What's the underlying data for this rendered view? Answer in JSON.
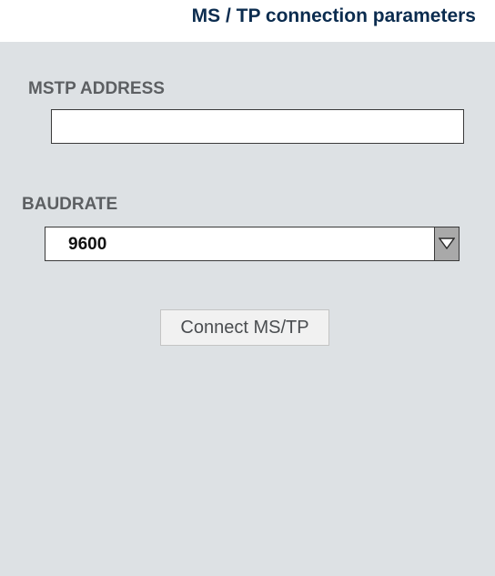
{
  "header": {
    "title": "MS / TP connection parameters"
  },
  "mstp_address": {
    "label": "MSTP ADDRESS",
    "value": "",
    "placeholder": ""
  },
  "baudrate": {
    "label": "BAUDRATE",
    "selected": "9600",
    "dropdown_icon": "triangle-down-icon"
  },
  "actions": {
    "connect_label": "Connect MS/TP"
  },
  "colors": {
    "title": "#0b2c4f",
    "panel_background": "#dde1e4",
    "label": "#5c5f62",
    "dropdown_button": "#a9a9a9",
    "button_background": "#f1f1f1"
  }
}
